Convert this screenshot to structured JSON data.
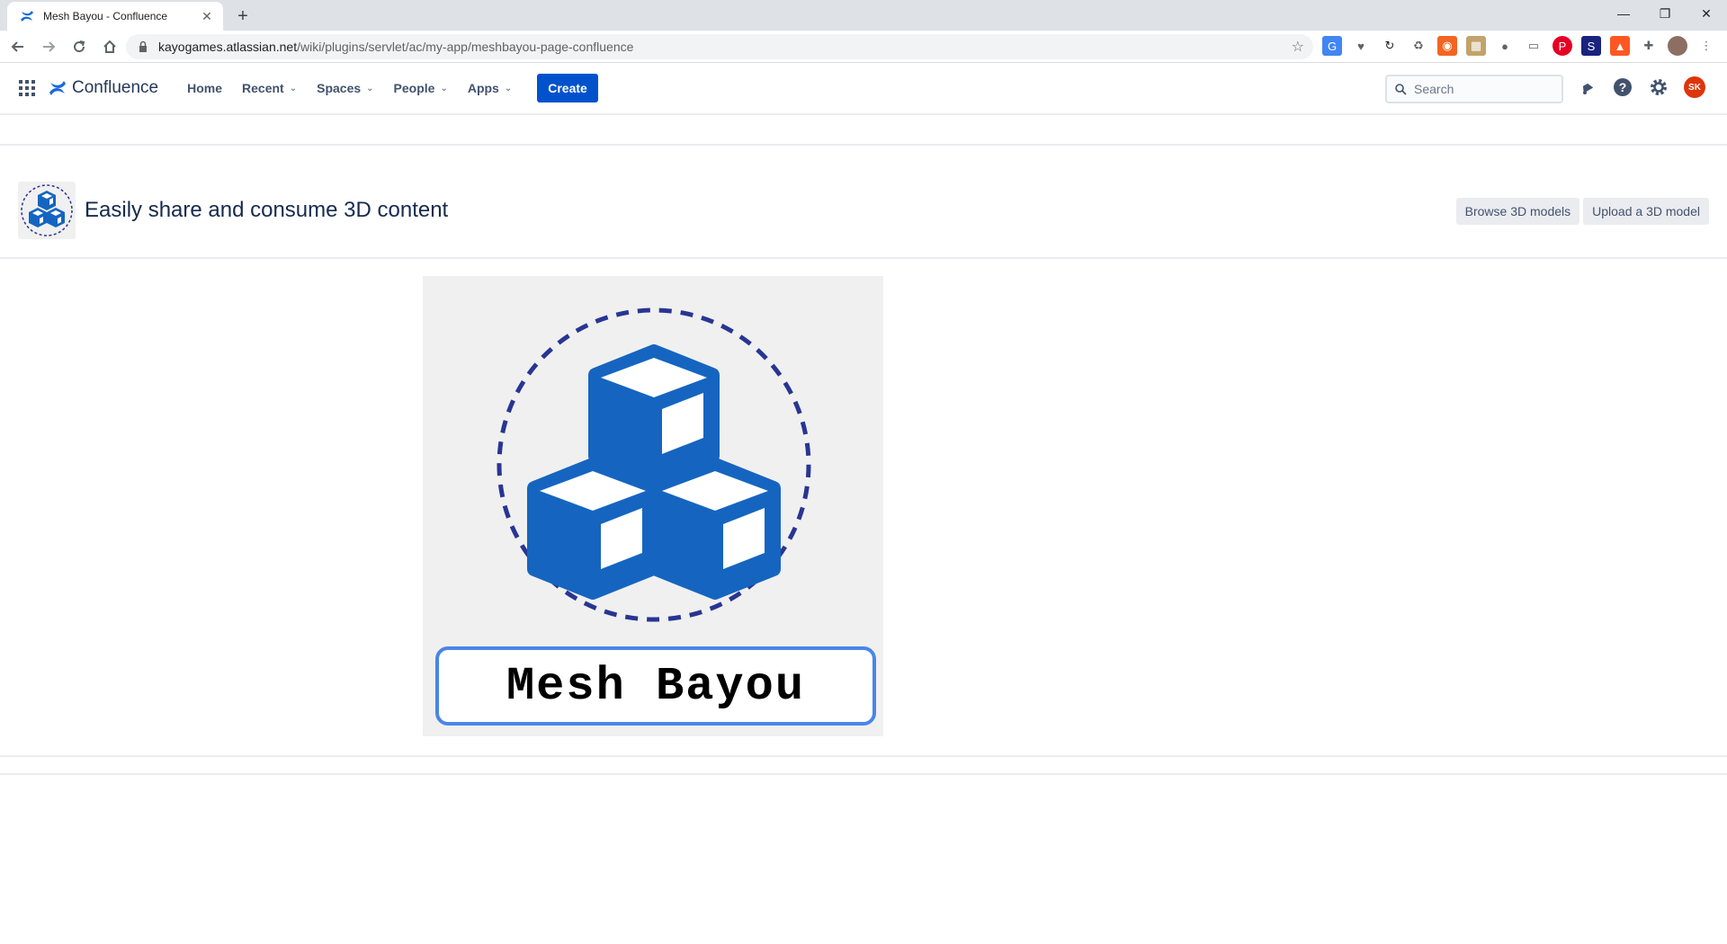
{
  "browser": {
    "tab_title": "Mesh Bayou - Confluence",
    "url_host": "kayogames.atlassian.net",
    "url_path": "/wiki/plugins/servlet/ac/my-app/meshbayou-page-confluence"
  },
  "confluence": {
    "logo_text": "Confluence",
    "nav": {
      "home": "Home",
      "recent": "Recent",
      "spaces": "Spaces",
      "people": "People",
      "apps": "Apps"
    },
    "create_label": "Create",
    "search_placeholder": "Search",
    "avatar_initials": "SK"
  },
  "app": {
    "heading": "Easily share and consume 3D content",
    "browse_label": "Browse 3D models",
    "upload_label": "Upload a 3D model",
    "hero_name": "Mesh Bayou"
  },
  "colors": {
    "brand_blue": "#1565c0",
    "circle_navy": "#283593",
    "create_blue": "#0052cc",
    "avatar_red": "#de350b"
  }
}
